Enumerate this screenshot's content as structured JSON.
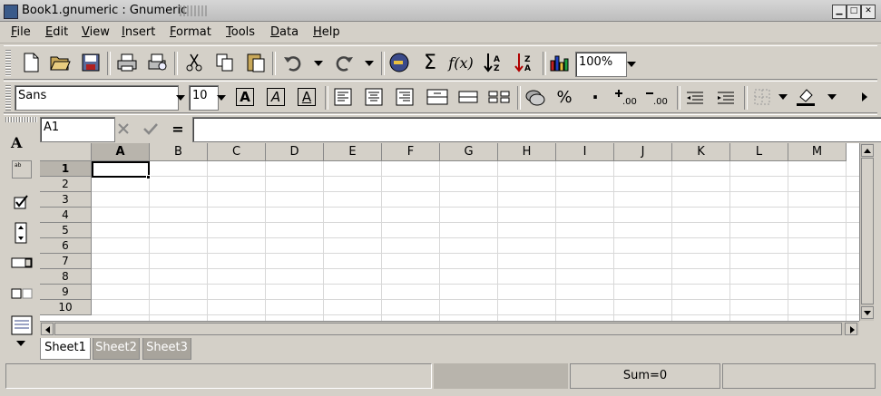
{
  "window": {
    "title": "Book1.gnumeric : Gnumeric"
  },
  "menubar": {
    "items": [
      {
        "label": "File",
        "mnemonic": "F",
        "rest": "ile"
      },
      {
        "label": "Edit",
        "mnemonic": "E",
        "rest": "dit"
      },
      {
        "label": "View",
        "mnemonic": "V",
        "rest": "iew"
      },
      {
        "label": "Insert",
        "mnemonic": "I",
        "rest": "nsert"
      },
      {
        "label": "Format",
        "mnemonic": "F",
        "rest": "ormat"
      },
      {
        "label": "Tools",
        "mnemonic": "T",
        "rest": "ools"
      },
      {
        "label": "Data",
        "mnemonic": "D",
        "rest": "ata"
      },
      {
        "label": "Help",
        "mnemonic": "H",
        "rest": "elp"
      }
    ]
  },
  "standard_toolbar": {
    "zoom": "100%",
    "function_label": "f(x)",
    "sum_label": "Σ"
  },
  "format_toolbar": {
    "font_name": "Sans",
    "font_size": "10",
    "bold_label": "A",
    "italic_label": "A",
    "underline_label": "A",
    "percent_label": "%",
    "thousands_label": "·"
  },
  "formula_bar": {
    "cell_ref": "A1",
    "equals_label": "=",
    "content": ""
  },
  "sheet": {
    "columns": [
      "A",
      "B",
      "C",
      "D",
      "E",
      "F",
      "G",
      "H",
      "I",
      "J",
      "K",
      "L",
      "M"
    ],
    "rows": [
      "1",
      "2",
      "3",
      "4",
      "5",
      "6",
      "7",
      "8",
      "9",
      "10"
    ],
    "selected_cell": "A1"
  },
  "tabs": [
    "Sheet1",
    "Sheet2",
    "Sheet3"
  ],
  "statusbar": {
    "sum": "Sum=0"
  },
  "left_toolbar": {
    "label_tool": "A",
    "frame_tool": "ab"
  },
  "colors": {
    "chrome": "#d4d0c8",
    "header_selected": "#b8b4ac",
    "grid_line": "#d8d8d8"
  }
}
